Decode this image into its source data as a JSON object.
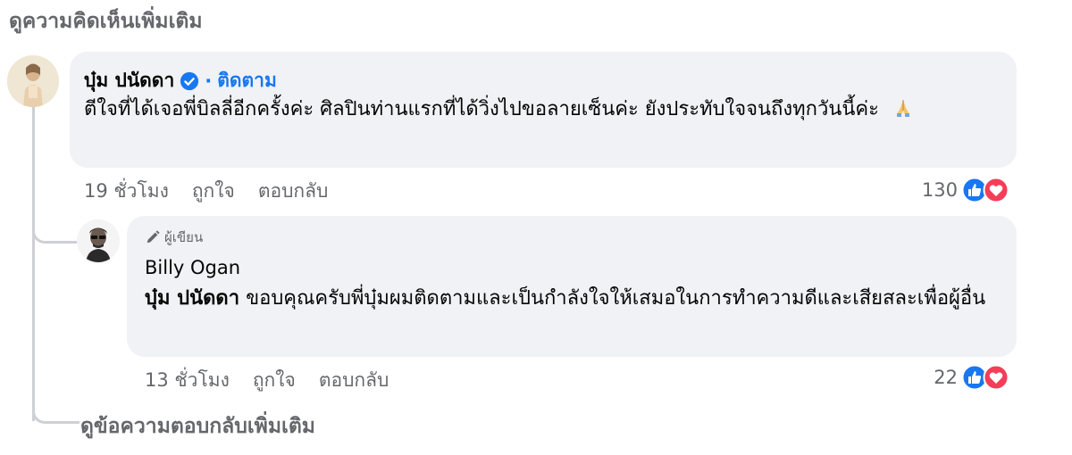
{
  "top": {
    "view_more_comments": "ดูความคิดเห็นเพิ่มเติม"
  },
  "comment": {
    "author": "บุ๋ม ปนัดดา",
    "verified_icon": "verified-badge-icon",
    "separator": "·",
    "follow_label": "ติดตาม",
    "text": "ตีใจที่ได้เจอพี่บิลลี่อีกครั้งค่ะ ศิลปินท่านแรกที่ได้วิ่งไปขอลายเซ็นค่ะ ยังประทับใจจนถึงทุกวันนี้ค่ะ",
    "emoji": "folded-hands-emoji",
    "time": "19 ชั่วโมง",
    "like_label": "ถูกใจ",
    "reply_label": "ตอบกลับ",
    "reaction_count": "130",
    "reaction_icons": [
      "like-icon",
      "love-icon"
    ]
  },
  "reply": {
    "badge_label": "ผู้เขียน",
    "badge_icon": "pencil-icon",
    "author": "Billy Ogan",
    "mention": "บุ๋ม ปนัดดา",
    "text": "ขอบคุณครับพี่บุ๋มผมติดตามและเป็นกำลังใจให้เสมอในการทำความดีและเสียสละเพื่อผู้อื่น",
    "time": "13 ชั่วโมง",
    "like_label": "ถูกใจ",
    "reply_label": "ตอบกลับ",
    "reaction_count": "22",
    "reaction_icons": [
      "like-icon",
      "love-icon"
    ]
  },
  "bottom": {
    "view_more_replies": "ดูข้อความตอบกลับเพิ่มเติม"
  },
  "colors": {
    "muted": "#65676b",
    "link_blue": "#1877f2",
    "bubble_bg": "#f0f2f5",
    "thread_line": "#ced0d4",
    "love_red": "#f33e58"
  }
}
